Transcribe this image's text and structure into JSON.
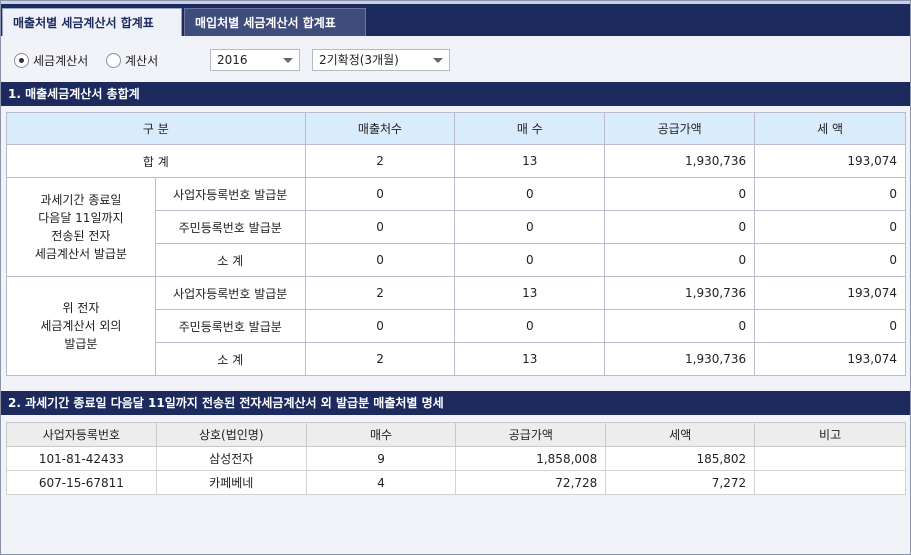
{
  "tabs": [
    {
      "label": "매출처별 세금계산서 합계표",
      "active": true
    },
    {
      "label": "매입처별 세금계산서 합계표",
      "active": false
    }
  ],
  "filters": {
    "radios": [
      {
        "label": "세금계산서",
        "checked": true
      },
      {
        "label": "계산서",
        "checked": false
      }
    ],
    "year": "2016",
    "period": "2기확정(3개월)"
  },
  "section1": {
    "title": "1. 매출세금계산서 총합계",
    "headers": [
      "구 분",
      "매출처수",
      "매 수",
      "공급가액",
      "세 액"
    ],
    "total": {
      "label": "합 계",
      "vendors": "2",
      "count": "13",
      "supply": "1,930,736",
      "tax": "193,074"
    },
    "groups": [
      {
        "label": "과세기간 종료일\n다음달 11일까지\n전송된 전자\n세금계산서 발급분",
        "rows": [
          {
            "label": "사업자등록번호 발급분",
            "vendors": "0",
            "count": "0",
            "supply": "0",
            "tax": "0"
          },
          {
            "label": "주민등록번호 발급분",
            "vendors": "0",
            "count": "0",
            "supply": "0",
            "tax": "0"
          },
          {
            "label": "소 계",
            "vendors": "0",
            "count": "0",
            "supply": "0",
            "tax": "0"
          }
        ]
      },
      {
        "label": "위 전자\n세금계산서 외의\n발급분",
        "rows": [
          {
            "label": "사업자등록번호 발급분",
            "vendors": "2",
            "count": "13",
            "supply": "1,930,736",
            "tax": "193,074"
          },
          {
            "label": "주민등록번호 발급분",
            "vendors": "0",
            "count": "0",
            "supply": "0",
            "tax": "0"
          },
          {
            "label": "소 계",
            "vendors": "2",
            "count": "13",
            "supply": "1,930,736",
            "tax": "193,074"
          }
        ]
      }
    ]
  },
  "section2": {
    "title": "2. 과세기간 종료일 다음달 11일까지 전송된 전자세금계산서 외 발급분 매출처별 명세",
    "headers": [
      "사업자등록번호",
      "상호(법인명)",
      "매수",
      "공급가액",
      "세액",
      "비고"
    ],
    "rows": [
      {
        "regno": "101-81-42433",
        "name": "삼성전자",
        "count": "9",
        "supply": "1,858,008",
        "tax": "185,802",
        "note": ""
      },
      {
        "regno": "607-15-67811",
        "name": "카페베네",
        "count": "4",
        "supply": "72,728",
        "tax": "7,272",
        "note": ""
      }
    ]
  }
}
